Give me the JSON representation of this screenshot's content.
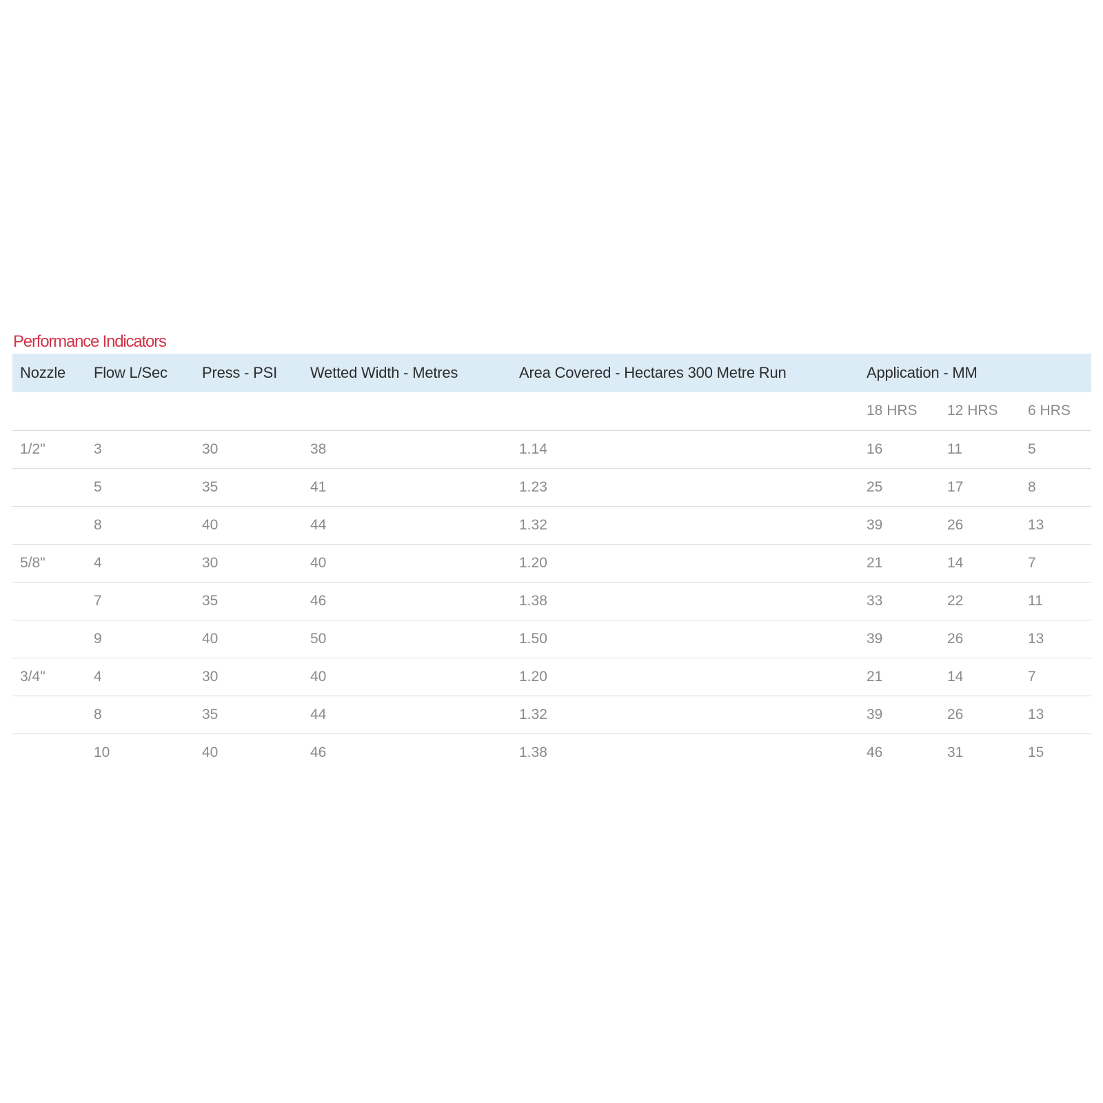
{
  "section_title": "Performance Indicators",
  "table": {
    "headers": {
      "nozzle": "Nozzle",
      "flow": "Flow L/Sec",
      "press": "Press - PSI",
      "wetted_width": "Wetted Width - Metres",
      "area_covered": "Area Covered - Hectares 300 Metre Run",
      "application": "Application - MM"
    },
    "sub_headers": {
      "hrs_18": "18 HRS",
      "hrs_12": "12 HRS",
      "hrs_6": "6 HRS"
    },
    "rows": [
      {
        "nozzle": "1/2\"",
        "flow": "3",
        "press": "30",
        "width": "38",
        "area": "1.14",
        "h18": "16",
        "h12": "11",
        "h6": "5"
      },
      {
        "nozzle": "",
        "flow": "5",
        "press": "35",
        "width": "41",
        "area": "1.23",
        "h18": "25",
        "h12": "17",
        "h6": "8"
      },
      {
        "nozzle": "",
        "flow": "8",
        "press": "40",
        "width": "44",
        "area": "1.32",
        "h18": "39",
        "h12": "26",
        "h6": "13"
      },
      {
        "nozzle": "5/8\"",
        "flow": "4",
        "press": "30",
        "width": "40",
        "area": "1.20",
        "h18": "21",
        "h12": "14",
        "h6": "7"
      },
      {
        "nozzle": "",
        "flow": "7",
        "press": "35",
        "width": "46",
        "area": "1.38",
        "h18": "33",
        "h12": "22",
        "h6": "11"
      },
      {
        "nozzle": "",
        "flow": "9",
        "press": "40",
        "width": "50",
        "area": "1.50",
        "h18": "39",
        "h12": "26",
        "h6": "13"
      },
      {
        "nozzle": "3/4\"",
        "flow": "4",
        "press": "30",
        "width": "40",
        "area": "1.20",
        "h18": "21",
        "h12": "14",
        "h6": "7"
      },
      {
        "nozzle": "",
        "flow": "8",
        "press": "35",
        "width": "44",
        "area": "1.32",
        "h18": "39",
        "h12": "26",
        "h6": "13"
      },
      {
        "nozzle": "",
        "flow": "10",
        "press": "40",
        "width": "46",
        "area": "1.38",
        "h18": "46",
        "h12": "31",
        "h6": "15"
      }
    ]
  },
  "colors": {
    "title": "#d0354a",
    "header_background": "#dcecf6",
    "header_text": "#2d2d2d",
    "cell_text": "#8a8a8a",
    "row_divider": "#dcdcdc"
  }
}
